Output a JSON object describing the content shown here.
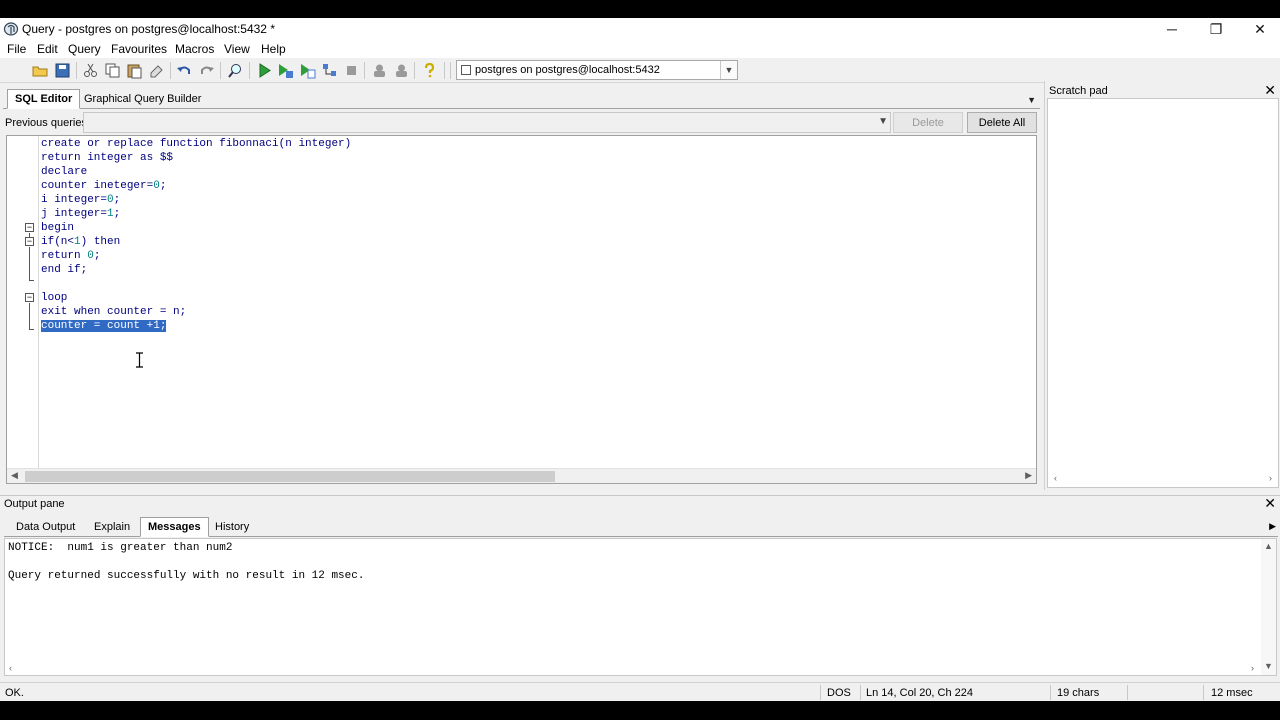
{
  "window": {
    "title": "Query - postgres on postgres@localhost:5432 *"
  },
  "menu": [
    "File",
    "Edit",
    "Query",
    "Favourites",
    "Macros",
    "View",
    "Help"
  ],
  "toolbar": {
    "connection": "postgres on postgres@localhost:5432"
  },
  "editor_tabs": {
    "sql_editor": "SQL Editor",
    "graphical_builder": "Graphical Query Builder"
  },
  "previous_queries": {
    "label": "Previous queries",
    "delete": "Delete",
    "delete_all": "Delete All"
  },
  "code": {
    "l1": "create or replace function fibonnaci(n integer)",
    "l2": "return integer as $$",
    "l3": "declare",
    "l4a": "counter ineteger=",
    "l4n": "0",
    "l4b": ";",
    "l5a": "i integer=",
    "l5n": "0",
    "l5b": ";",
    "l6a": "j integer=",
    "l6n": "1",
    "l6b": ";",
    "l7": "begin",
    "l8a": "if(n<",
    "l8n": "1",
    "l8b": ") then",
    "l9a": "return ",
    "l9n": "0",
    "l9b": ";",
    "l10": "end if;",
    "l12": "loop",
    "l13": "exit when counter = n;",
    "l14": "counter = count +1;"
  },
  "scratch_pad": {
    "title": "Scratch pad"
  },
  "output_pane": {
    "title": "Output pane",
    "tabs": [
      "Data Output",
      "Explain",
      "Messages",
      "History"
    ],
    "messages": [
      "NOTICE:  num1 is greater than num2",
      "Query returned successfully with no result in 12 msec."
    ]
  },
  "status": {
    "state": "OK.",
    "line_ending": "DOS",
    "position": "Ln 14, Col 20, Ch 224",
    "chars": "19 chars",
    "time": "12 msec"
  }
}
